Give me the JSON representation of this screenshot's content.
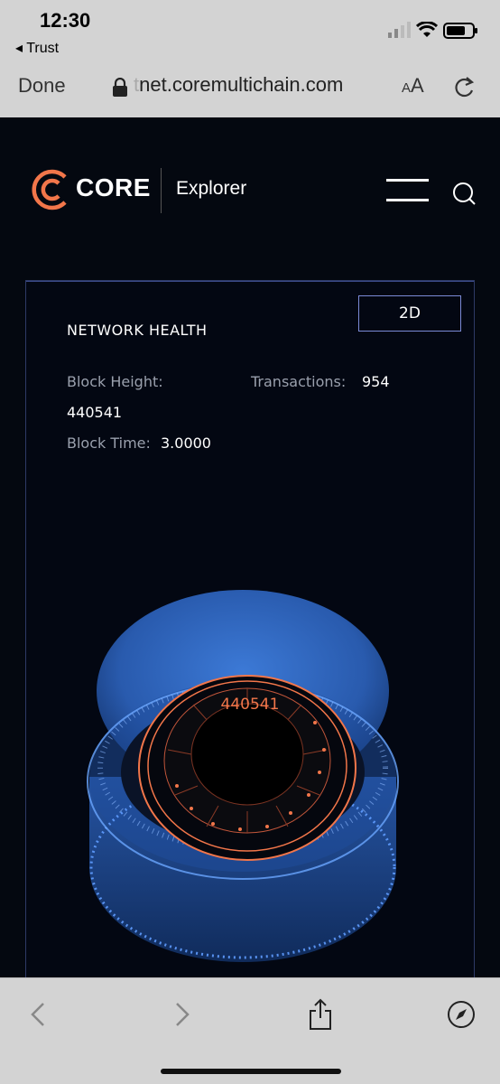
{
  "status_bar": {
    "time": "12:30",
    "back_app": "◂ Trust"
  },
  "safari": {
    "done_label": "Done",
    "url_faded": "t",
    "url": "net.coremultichain.com",
    "text_size_small": "A",
    "text_size_large": "A"
  },
  "header": {
    "brand": "CORE",
    "section": "Explorer"
  },
  "network_health": {
    "title": "NETWORK HEALTH",
    "toggle_label": "2D",
    "block_height_label": "Block Height:",
    "block_height_value": "440541",
    "transactions_label": "Transactions:",
    "transactions_value": "954",
    "block_time_label": "Block Time:",
    "block_time_value": "3.0000",
    "viz_block_number": "440541"
  },
  "colors": {
    "accent": "#f2764a",
    "bg": "#040810",
    "blue": "#3a78e0"
  }
}
